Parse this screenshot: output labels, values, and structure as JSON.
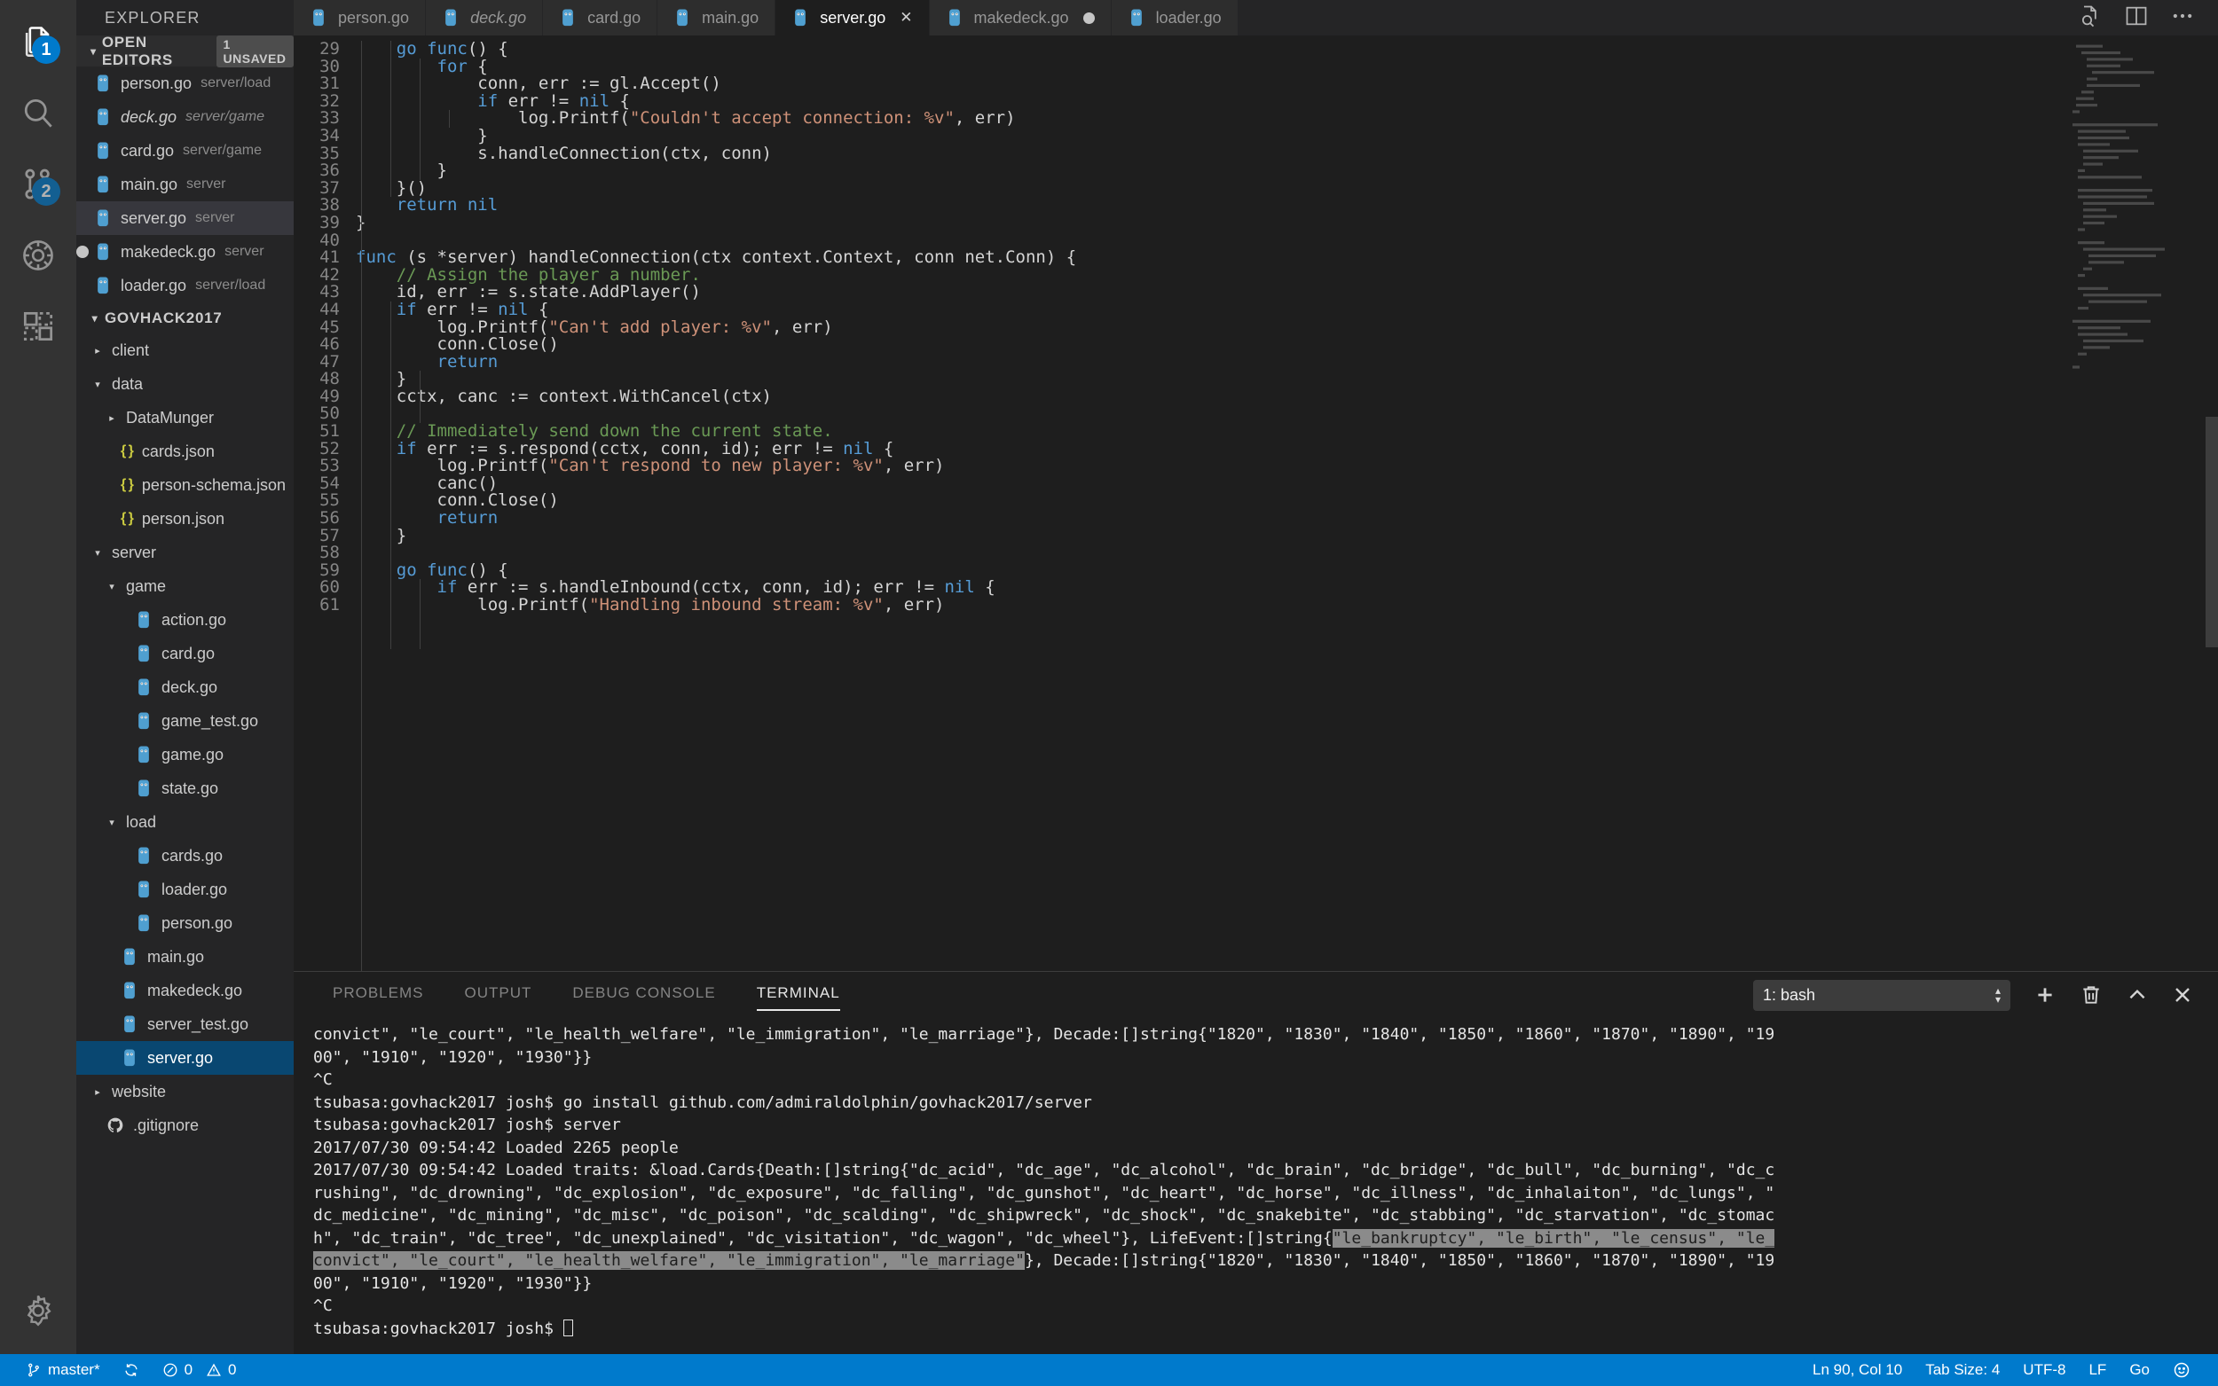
{
  "activitybar": {
    "items": [
      {
        "name": "explorer",
        "icon": "files-icon",
        "badge": "1",
        "active": true
      },
      {
        "name": "search",
        "icon": "search-icon",
        "badge": "",
        "active": false
      },
      {
        "name": "source-control",
        "icon": "source-control-icon",
        "badge": "2",
        "active": false
      },
      {
        "name": "debug",
        "icon": "debug-icon",
        "badge": "",
        "active": false
      },
      {
        "name": "extensions",
        "icon": "extensions-icon",
        "badge": "",
        "active": false
      }
    ],
    "settings_icon": "gear-icon"
  },
  "sidebar": {
    "title": "EXPLORER",
    "open_editors": {
      "label": "OPEN EDITORS",
      "badge": "1 UNSAVED",
      "items": [
        {
          "name": "person.go",
          "path": "server/load",
          "dirty": false,
          "italic": false,
          "selected": false
        },
        {
          "name": "deck.go",
          "path": "server/game",
          "dirty": false,
          "italic": true,
          "selected": false
        },
        {
          "name": "card.go",
          "path": "server/game",
          "dirty": false,
          "italic": false,
          "selected": false
        },
        {
          "name": "main.go",
          "path": "server",
          "dirty": false,
          "italic": false,
          "selected": false
        },
        {
          "name": "server.go",
          "path": "server",
          "dirty": false,
          "italic": false,
          "selected": true
        },
        {
          "name": "makedeck.go",
          "path": "server",
          "dirty": true,
          "italic": false,
          "selected": false
        },
        {
          "name": "loader.go",
          "path": "server/load",
          "dirty": false,
          "italic": false,
          "selected": false
        }
      ]
    },
    "workspace": {
      "label": "GOVHACK2017",
      "tree": [
        {
          "label": "client",
          "type": "folder",
          "state": "collapsed",
          "depth": 1
        },
        {
          "label": "data",
          "type": "folder",
          "state": "expanded",
          "depth": 1
        },
        {
          "label": "DataMunger",
          "type": "folder",
          "state": "collapsed",
          "depth": 2
        },
        {
          "label": "cards.json",
          "type": "json",
          "state": "",
          "depth": 2
        },
        {
          "label": "person-schema.json",
          "type": "json",
          "state": "",
          "depth": 2
        },
        {
          "label": "person.json",
          "type": "json",
          "state": "",
          "depth": 2
        },
        {
          "label": "server",
          "type": "folder",
          "state": "expanded",
          "depth": 1
        },
        {
          "label": "game",
          "type": "folder",
          "state": "expanded",
          "depth": 2
        },
        {
          "label": "action.go",
          "type": "go",
          "state": "",
          "depth": 3
        },
        {
          "label": "card.go",
          "type": "go",
          "state": "",
          "depth": 3
        },
        {
          "label": "deck.go",
          "type": "go",
          "state": "",
          "depth": 3
        },
        {
          "label": "game_test.go",
          "type": "go",
          "state": "",
          "depth": 3
        },
        {
          "label": "game.go",
          "type": "go",
          "state": "",
          "depth": 3
        },
        {
          "label": "state.go",
          "type": "go",
          "state": "",
          "depth": 3
        },
        {
          "label": "load",
          "type": "folder",
          "state": "expanded",
          "depth": 2
        },
        {
          "label": "cards.go",
          "type": "go",
          "state": "",
          "depth": 3
        },
        {
          "label": "loader.go",
          "type": "go",
          "state": "",
          "depth": 3
        },
        {
          "label": "person.go",
          "type": "go",
          "state": "",
          "depth": 3
        },
        {
          "label": "main.go",
          "type": "go",
          "state": "",
          "depth": 2
        },
        {
          "label": "makedeck.go",
          "type": "go",
          "state": "",
          "depth": 2
        },
        {
          "label": "server_test.go",
          "type": "go",
          "state": "",
          "depth": 2
        },
        {
          "label": "server.go",
          "type": "go",
          "state": "",
          "depth": 2,
          "selected": true
        },
        {
          "label": "website",
          "type": "folder",
          "state": "collapsed",
          "depth": 1
        },
        {
          "label": ".gitignore",
          "type": "git",
          "state": "",
          "depth": 1
        }
      ]
    }
  },
  "editor": {
    "tabs": [
      {
        "label": "person.go",
        "active": false,
        "dirty": false,
        "italic": false,
        "closeable": false
      },
      {
        "label": "deck.go",
        "active": false,
        "dirty": false,
        "italic": true,
        "closeable": false
      },
      {
        "label": "card.go",
        "active": false,
        "dirty": false,
        "italic": false,
        "closeable": false
      },
      {
        "label": "main.go",
        "active": false,
        "dirty": false,
        "italic": false,
        "closeable": false
      },
      {
        "label": "server.go",
        "active": true,
        "dirty": false,
        "italic": false,
        "closeable": true
      },
      {
        "label": "makedeck.go",
        "active": false,
        "dirty": true,
        "italic": false,
        "closeable": false
      },
      {
        "label": "loader.go",
        "active": false,
        "dirty": false,
        "italic": false,
        "closeable": false
      }
    ],
    "close_glyph": "✕",
    "actions": [
      {
        "name": "open-changes-icon"
      },
      {
        "name": "split-editor-icon"
      },
      {
        "name": "more-actions-icon"
      }
    ],
    "first_line_number": 29,
    "lines": [
      {
        "n": 29,
        "tokens": [
          {
            "t": "    ",
            "c": ""
          },
          {
            "t": "go",
            "c": "kw"
          },
          {
            "t": " ",
            "c": ""
          },
          {
            "t": "func",
            "c": "kw"
          },
          {
            "t": "() {",
            "c": ""
          }
        ]
      },
      {
        "n": 30,
        "tokens": [
          {
            "t": "        ",
            "c": ""
          },
          {
            "t": "for",
            "c": "kw"
          },
          {
            "t": " {",
            "c": ""
          }
        ]
      },
      {
        "n": 31,
        "tokens": [
          {
            "t": "            conn, err := gl.Accept()",
            "c": ""
          }
        ]
      },
      {
        "n": 32,
        "tokens": [
          {
            "t": "            ",
            "c": ""
          },
          {
            "t": "if",
            "c": "kw"
          },
          {
            "t": " err != ",
            "c": ""
          },
          {
            "t": "nil",
            "c": "kw"
          },
          {
            "t": " {",
            "c": ""
          }
        ]
      },
      {
        "n": 33,
        "tokens": [
          {
            "t": "                log.Printf(",
            "c": ""
          },
          {
            "t": "\"Couldn't accept connection: %v\"",
            "c": "str"
          },
          {
            "t": ", err)",
            "c": ""
          }
        ]
      },
      {
        "n": 34,
        "tokens": [
          {
            "t": "            }",
            "c": ""
          }
        ]
      },
      {
        "n": 35,
        "tokens": [
          {
            "t": "            s.handleConnection(ctx, conn)",
            "c": ""
          }
        ]
      },
      {
        "n": 36,
        "tokens": [
          {
            "t": "        }",
            "c": ""
          }
        ]
      },
      {
        "n": 37,
        "tokens": [
          {
            "t": "    }()",
            "c": ""
          }
        ]
      },
      {
        "n": 38,
        "tokens": [
          {
            "t": "    ",
            "c": ""
          },
          {
            "t": "return",
            "c": "kw"
          },
          {
            "t": " ",
            "c": ""
          },
          {
            "t": "nil",
            "c": "kw"
          }
        ]
      },
      {
        "n": 39,
        "tokens": [
          {
            "t": "}",
            "c": ""
          }
        ]
      },
      {
        "n": 40,
        "tokens": [
          {
            "t": "",
            "c": ""
          }
        ]
      },
      {
        "n": 41,
        "tokens": [
          {
            "t": "func",
            "c": "kw"
          },
          {
            "t": " (s *server) handleConnection(ctx context.Context, conn net.Conn) {",
            "c": ""
          }
        ]
      },
      {
        "n": 42,
        "tokens": [
          {
            "t": "    ",
            "c": ""
          },
          {
            "t": "// Assign the player a number.",
            "c": "cmt"
          }
        ]
      },
      {
        "n": 43,
        "tokens": [
          {
            "t": "    id, err := s.state.AddPlayer()",
            "c": ""
          }
        ]
      },
      {
        "n": 44,
        "tokens": [
          {
            "t": "    ",
            "c": ""
          },
          {
            "t": "if",
            "c": "kw"
          },
          {
            "t": " err != ",
            "c": ""
          },
          {
            "t": "nil",
            "c": "kw"
          },
          {
            "t": " {",
            "c": ""
          }
        ]
      },
      {
        "n": 45,
        "tokens": [
          {
            "t": "        log.Printf(",
            "c": ""
          },
          {
            "t": "\"Can't add player: %v\"",
            "c": "str"
          },
          {
            "t": ", err)",
            "c": ""
          }
        ]
      },
      {
        "n": 46,
        "tokens": [
          {
            "t": "        conn.Close()",
            "c": ""
          }
        ]
      },
      {
        "n": 47,
        "tokens": [
          {
            "t": "        ",
            "c": ""
          },
          {
            "t": "return",
            "c": "kw"
          }
        ]
      },
      {
        "n": 48,
        "tokens": [
          {
            "t": "    }",
            "c": ""
          }
        ]
      },
      {
        "n": 49,
        "tokens": [
          {
            "t": "    cctx, canc := context.WithCancel(ctx)",
            "c": ""
          }
        ]
      },
      {
        "n": 50,
        "tokens": [
          {
            "t": "",
            "c": ""
          }
        ]
      },
      {
        "n": 51,
        "tokens": [
          {
            "t": "    ",
            "c": ""
          },
          {
            "t": "// Immediately send down the current state.",
            "c": "cmt"
          }
        ]
      },
      {
        "n": 52,
        "tokens": [
          {
            "t": "    ",
            "c": ""
          },
          {
            "t": "if",
            "c": "kw"
          },
          {
            "t": " err := s.respond(cctx, conn, id); err != ",
            "c": ""
          },
          {
            "t": "nil",
            "c": "kw"
          },
          {
            "t": " {",
            "c": ""
          }
        ]
      },
      {
        "n": 53,
        "tokens": [
          {
            "t": "        log.Printf(",
            "c": ""
          },
          {
            "t": "\"Can't respond to new player: %v\"",
            "c": "str"
          },
          {
            "t": ", err)",
            "c": ""
          }
        ]
      },
      {
        "n": 54,
        "tokens": [
          {
            "t": "        canc()",
            "c": ""
          }
        ]
      },
      {
        "n": 55,
        "tokens": [
          {
            "t": "        conn.Close()",
            "c": ""
          }
        ]
      },
      {
        "n": 56,
        "tokens": [
          {
            "t": "        ",
            "c": ""
          },
          {
            "t": "return",
            "c": "kw"
          }
        ]
      },
      {
        "n": 57,
        "tokens": [
          {
            "t": "    }",
            "c": ""
          }
        ]
      },
      {
        "n": 58,
        "tokens": [
          {
            "t": "",
            "c": ""
          }
        ]
      },
      {
        "n": 59,
        "tokens": [
          {
            "t": "    ",
            "c": ""
          },
          {
            "t": "go",
            "c": "kw"
          },
          {
            "t": " ",
            "c": ""
          },
          {
            "t": "func",
            "c": "kw"
          },
          {
            "t": "() {",
            "c": ""
          }
        ]
      },
      {
        "n": 60,
        "tokens": [
          {
            "t": "        ",
            "c": ""
          },
          {
            "t": "if",
            "c": "kw"
          },
          {
            "t": " err := s.handleInbound(cctx, conn, id); err != ",
            "c": ""
          },
          {
            "t": "nil",
            "c": "kw"
          },
          {
            "t": " {",
            "c": ""
          }
        ]
      },
      {
        "n": 61,
        "tokens": [
          {
            "t": "            log.Printf(",
            "c": ""
          },
          {
            "t": "\"Handling inbound stream: %v\"",
            "c": "str"
          },
          {
            "t": ", err)",
            "c": ""
          }
        ]
      }
    ]
  },
  "panel": {
    "tabs": [
      {
        "label": "PROBLEMS",
        "active": false
      },
      {
        "label": "OUTPUT",
        "active": false
      },
      {
        "label": "DEBUG CONSOLE",
        "active": false
      },
      {
        "label": "TERMINAL",
        "active": true
      }
    ],
    "terminal_select": "1: bash",
    "actions": [
      {
        "name": "new-terminal-icon",
        "glyph": "+"
      },
      {
        "name": "kill-terminal-icon",
        "glyph": "trash"
      },
      {
        "name": "maximize-panel-icon",
        "glyph": "chevron-up"
      },
      {
        "name": "close-panel-icon",
        "glyph": "✕"
      }
    ],
    "terminal_lines": [
      {
        "segments": [
          {
            "t": "convict\", \"le_court\", \"le_health_welfare\", \"le_immigration\", \"le_marriage\"}, Decade:[]string{\"1820\", \"1830\", \"1840\", \"1850\", \"1860\", \"1870\", \"1890\", \"19",
            "sel": false
          }
        ]
      },
      {
        "segments": [
          {
            "t": "00\", \"1910\", \"1920\", \"1930\"}}",
            "sel": false
          }
        ]
      },
      {
        "segments": [
          {
            "t": "^C",
            "sel": false
          }
        ]
      },
      {
        "segments": [
          {
            "t": "tsubasa:govhack2017 josh$ go install github.com/admiraldolphin/govhack2017/server",
            "sel": false
          }
        ]
      },
      {
        "segments": [
          {
            "t": "tsubasa:govhack2017 josh$ server",
            "sel": false
          }
        ]
      },
      {
        "segments": [
          {
            "t": "2017/07/30 09:54:42 Loaded 2265 people",
            "sel": false
          }
        ]
      },
      {
        "segments": [
          {
            "t": "2017/07/30 09:54:42 Loaded traits: &load.Cards{Death:[]string{\"dc_acid\", \"dc_age\", \"dc_alcohol\", \"dc_brain\", \"dc_bridge\", \"dc_bull\", \"dc_burning\", \"dc_c",
            "sel": false
          }
        ]
      },
      {
        "segments": [
          {
            "t": "rushing\", \"dc_drowning\", \"dc_explosion\", \"dc_exposure\", \"dc_falling\", \"dc_gunshot\", \"dc_heart\", \"dc_horse\", \"dc_illness\", \"dc_inhalaiton\", \"dc_lungs\", \"",
            "sel": false
          }
        ]
      },
      {
        "segments": [
          {
            "t": "dc_medicine\", \"dc_mining\", \"dc_misc\", \"dc_poison\", \"dc_scalding\", \"dc_shipwreck\", \"dc_shock\", \"dc_snakebite\", \"dc_stabbing\", \"dc_starvation\", \"dc_stomac",
            "sel": false
          }
        ]
      },
      {
        "segments": [
          {
            "t": "h\", \"dc_train\", \"dc_tree\", \"dc_unexplained\", \"dc_visitation\", \"dc_wagon\", \"dc_wheel\"}, LifeEvent:[]string{",
            "sel": false
          },
          {
            "t": "\"le_bankruptcy\", \"le_birth\", \"le_census\", \"le_",
            "sel": true
          }
        ]
      },
      {
        "segments": [
          {
            "t": "convict\", \"le_court\", \"le_health_welfare\", \"le_immigration\", \"le_marriage\"",
            "sel": true
          },
          {
            "t": "}, Decade:[]string{\"1820\", \"1830\", \"1840\", \"1850\", \"1860\", \"1870\", \"1890\", \"19",
            "sel": false
          }
        ]
      },
      {
        "segments": [
          {
            "t": "00\", \"1910\", \"1920\", \"1930\"}}",
            "sel": false
          }
        ]
      },
      {
        "segments": [
          {
            "t": "^C",
            "sel": false
          }
        ]
      },
      {
        "segments": [
          {
            "t": "tsubasa:govhack2017 josh$ ",
            "sel": false,
            "cursor": true
          }
        ]
      }
    ]
  },
  "statusbar": {
    "branch": "master*",
    "sync_icon": "sync-icon",
    "errors": "0",
    "warnings": "0",
    "cursor_position": "Ln 90, Col 10",
    "tab_size": "Tab Size: 4",
    "encoding": "UTF-8",
    "eol": "LF",
    "language": "Go",
    "feedback_icon": "smiley-icon",
    "accent": "#007acc"
  }
}
